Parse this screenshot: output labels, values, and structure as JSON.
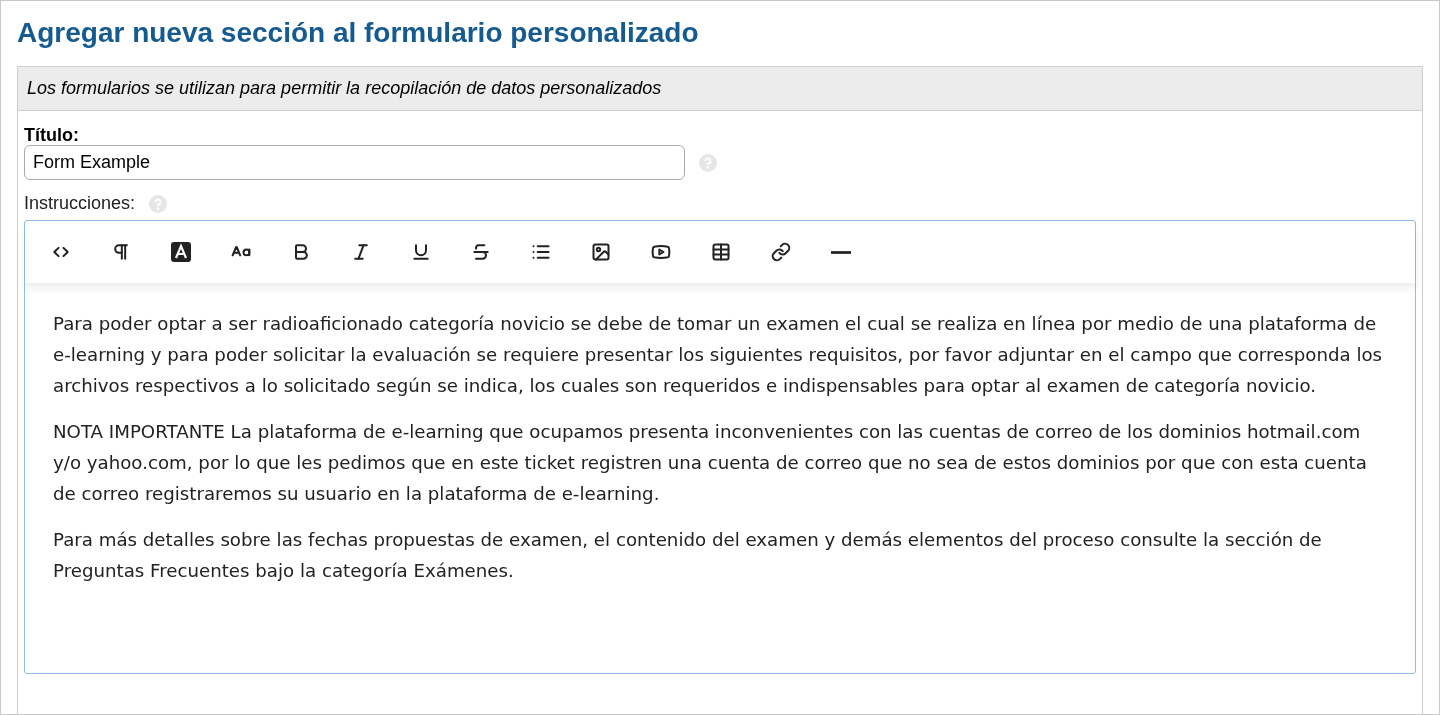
{
  "title": "Agregar nueva sección al formulario personalizado",
  "description": "Los formularios se utilizan para permitir la recopilación de datos personalizados",
  "title_field": {
    "label": "Título:",
    "value": "Form Example"
  },
  "instructions": {
    "label": "Instrucciones:",
    "toolbar": [
      {
        "kind": "code"
      },
      {
        "kind": "paragraph"
      },
      {
        "kind": "color"
      },
      {
        "kind": "font-size"
      },
      {
        "kind": "bold"
      },
      {
        "kind": "italic"
      },
      {
        "kind": "underline"
      },
      {
        "kind": "strikethrough"
      },
      {
        "kind": "list"
      },
      {
        "kind": "image"
      },
      {
        "kind": "video"
      },
      {
        "kind": "table"
      },
      {
        "kind": "link"
      },
      {
        "kind": "rule"
      }
    ],
    "paragraphs": [
      "Para poder optar a ser radioaficionado categoría novicio se debe de tomar un examen el cual se realiza en línea por medio de una plataforma de e-learning y para poder solicitar la evaluación se requiere presentar los siguientes requisitos, por favor adjuntar en el campo que corresponda los archivos respectivos a lo solicitado según se indica, los cuales son requeridos e indispensables para optar al examen de categoría novicio.",
      "NOTA IMPORTANTE La plataforma de e-learning que ocupamos presenta inconvenientes con las cuentas de correo de los dominios hotmail.com y/o yahoo.com, por lo que les pedimos que en este ticket registren una cuenta de correo que no sea de estos dominios por que con esta cuenta de correo registraremos su usuario en la plataforma de e-learning.",
      "Para más detalles sobre las fechas propuestas de examen, el contenido del examen y demás elementos del proceso consulte la sección de Preguntas Frecuentes bajo la categoría Exámenes."
    ]
  }
}
